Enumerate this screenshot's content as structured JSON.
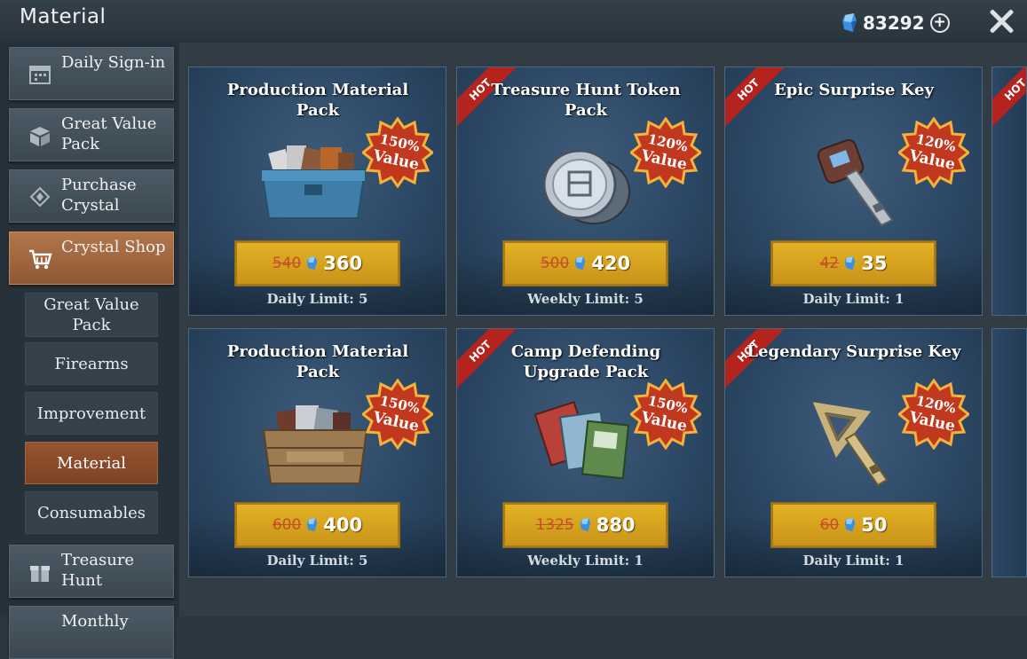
{
  "header": {
    "title": "Material",
    "currency": "83292",
    "plus": "+"
  },
  "sidebar": {
    "items": [
      {
        "label": "Daily Sign-in"
      },
      {
        "label": "Great Value Pack"
      },
      {
        "label": "Purchase Crystal"
      },
      {
        "label": "Crystal Shop"
      }
    ],
    "subitems": [
      {
        "label": "Great Value Pack"
      },
      {
        "label": "Firearms"
      },
      {
        "label": "Improvement"
      },
      {
        "label": "Material"
      },
      {
        "label": "Consumables"
      }
    ],
    "bottom_items": [
      {
        "label": "Treasure Hunt"
      },
      {
        "label": "Monthly"
      }
    ]
  },
  "cards": [
    {
      "title": "Production Material Pack",
      "hot": false,
      "value_pct": "150%",
      "value_word": "Value",
      "old_price": "540",
      "price": "360",
      "limit": "Daily Limit: 5"
    },
    {
      "title": "Treasure Hunt Token Pack",
      "hot": true,
      "hot_label": "HOT",
      "value_pct": "120%",
      "value_word": "Value",
      "old_price": "500",
      "price": "420",
      "limit": "Weekly Limit: 5"
    },
    {
      "title": "Epic Surprise Key",
      "hot": true,
      "hot_label": "HOT",
      "value_pct": "120%",
      "value_word": "Value",
      "old_price": "42",
      "price": "35",
      "limit": "Daily Limit: 1"
    },
    {
      "title": "Production Material Pack",
      "hot": false,
      "value_pct": "150%",
      "value_word": "Value",
      "old_price": "600",
      "price": "400",
      "limit": "Daily Limit: 5"
    },
    {
      "title": "Camp Defending Upgrade Pack",
      "hot": true,
      "hot_label": "HOT",
      "value_pct": "150%",
      "value_word": "Value",
      "old_price": "1325",
      "price": "880",
      "limit": "Weekly Limit: 1"
    },
    {
      "title": "Legendary Surprise Key",
      "hot": true,
      "hot_label": "HOT",
      "value_pct": "120%",
      "value_word": "Value",
      "old_price": "60",
      "price": "50",
      "limit": "Daily Limit: 1"
    }
  ],
  "partial_hot_label": "HOT",
  "icons": [
    "calendar-icon",
    "box-icon",
    "crystal-ticket-icon",
    "cart-icon",
    "gift-icon",
    "crystal-icon",
    "close-icon",
    "plus-icon"
  ],
  "colors": {
    "accent_active": "#a86c43",
    "price_gold": "#d9a21f",
    "hot_red": "#b4231e",
    "badge_red": "#c0391f"
  }
}
